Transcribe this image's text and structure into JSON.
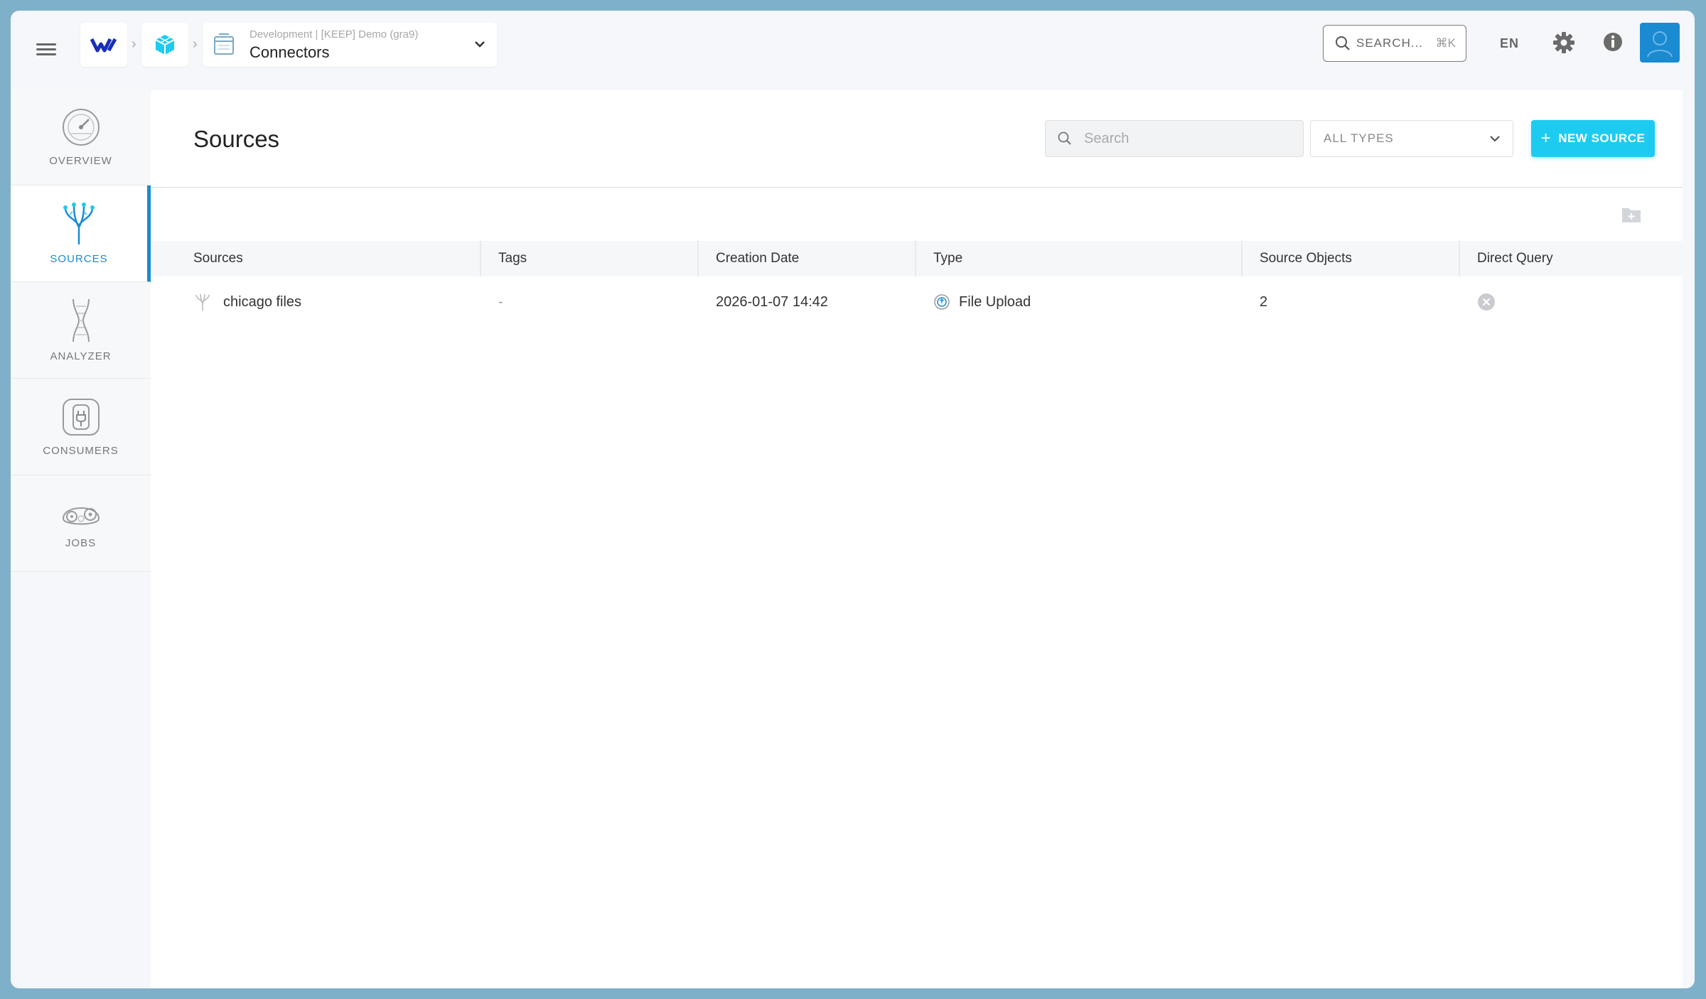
{
  "breadcrumb": {
    "project_subtitle": "Development | [KEEP] Demo (gra9)",
    "project_title": "Connectors"
  },
  "topbar": {
    "search_label": "SEARCH...",
    "search_shortcut": "⌘K",
    "language": "EN"
  },
  "sidebar": {
    "items": [
      {
        "label": "OVERVIEW",
        "icon": "overview-icon",
        "active": false
      },
      {
        "label": "SOURCES",
        "icon": "sources-icon",
        "active": true
      },
      {
        "label": "ANALYZER",
        "icon": "analyzer-icon",
        "active": false
      },
      {
        "label": "CONSUMERS",
        "icon": "consumers-icon",
        "active": false
      },
      {
        "label": "JOBS",
        "icon": "jobs-icon",
        "active": false
      }
    ]
  },
  "main": {
    "title": "Sources",
    "search_placeholder": "Search",
    "type_filter": "ALL TYPES",
    "new_button": "NEW SOURCE"
  },
  "table": {
    "columns": [
      "Sources",
      "Tags",
      "Creation Date",
      "Type",
      "Source Objects",
      "Direct Query"
    ],
    "rows": [
      {
        "name": "chicago files",
        "tags": "-",
        "creation_date": "2026-01-07 14:42",
        "type": "File Upload",
        "source_objects": "2",
        "direct_query": false
      }
    ]
  },
  "colors": {
    "accent": "#1a8bd1",
    "button": "#1ecbf0",
    "frame": "#7fb0c9"
  }
}
